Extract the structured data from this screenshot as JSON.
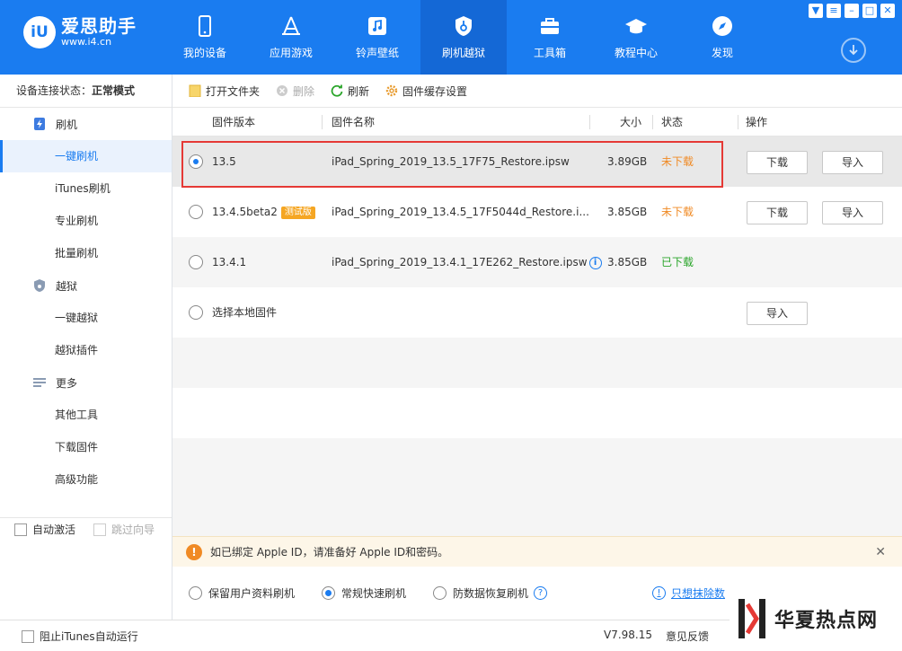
{
  "app": {
    "logo_mark": "iU",
    "name": "爱思助手",
    "url": "www.i4.cn"
  },
  "nav": {
    "items": [
      {
        "label": "我的设备",
        "icon": "phone-icon"
      },
      {
        "label": "应用游戏",
        "icon": "appstore-icon"
      },
      {
        "label": "铃声壁纸",
        "icon": "music-icon"
      },
      {
        "label": "刷机越狱",
        "icon": "shield-icon",
        "active": true
      },
      {
        "label": "工具箱",
        "icon": "toolbox-icon"
      },
      {
        "label": "教程中心",
        "icon": "graduation-cap-icon"
      },
      {
        "label": "发现",
        "icon": "compass-icon"
      }
    ],
    "download_icon": "download-circle-icon",
    "window_controls": [
      "shirt-icon",
      "menu-icon",
      "minimize-icon",
      "maximize-icon",
      "close-icon"
    ]
  },
  "sidebar": {
    "status_label": "设备连接状态：",
    "status_value": "正常模式",
    "groups": [
      {
        "label": "刷机",
        "icon": "flash-icon",
        "items": [
          "一键刷机",
          "iTunes刷机",
          "专业刷机",
          "批量刷机"
        ]
      },
      {
        "label": "越狱",
        "icon": "shield-icon",
        "items": [
          "一键越狱",
          "越狱插件"
        ]
      },
      {
        "label": "更多",
        "icon": "menu-lines-icon",
        "items": [
          "其他工具",
          "下载固件",
          "高级功能"
        ]
      }
    ],
    "active_item": "一键刷机",
    "auto_activate": "自动激活",
    "skip_guide": "跳过向导"
  },
  "toolbar": {
    "open_folder": "打开文件夹",
    "delete": "删除",
    "refresh": "刷新",
    "cache_settings": "固件缓存设置"
  },
  "table": {
    "headers": {
      "version": "固件版本",
      "name": "固件名称",
      "size": "大小",
      "status": "状态",
      "action": "操作"
    },
    "rows": [
      {
        "version": "13.5",
        "name": "iPad_Spring_2019_13.5_17F75_Restore.ipsw",
        "size": "3.89GB",
        "status": "未下载",
        "selected": true,
        "btn_download": "下载",
        "btn_import": "导入"
      },
      {
        "version": "13.4.5beta2",
        "badge": "测试版",
        "name": "iPad_Spring_2019_13.4.5_17F5044d_Restore.i...",
        "size": "3.85GB",
        "status": "未下载",
        "btn_download": "下载",
        "btn_import": "导入"
      },
      {
        "version": "13.4.1",
        "name": "iPad_Spring_2019_13.4.1_17E262_Restore.ipsw",
        "size": "3.85GB",
        "status": "已下载"
      },
      {
        "version": "选择本地固件",
        "btn_import": "导入"
      }
    ],
    "status_colors": {
      "not_downloaded": "#f08a24",
      "downloaded": "#2aa52a"
    }
  },
  "notice": {
    "text": "如已绑定 Apple ID，请准备好 Apple ID和密码。"
  },
  "modes": {
    "options": [
      "保留用户资料刷机",
      "常规快速刷机",
      "防数据恢复刷机"
    ],
    "selected": "常规快速刷机",
    "erase_link": "只想抹除数"
  },
  "statusbar": {
    "block_itunes": "阻止iTunes自动运行",
    "version": "V7.98.15",
    "feedback": "意见反馈"
  },
  "watermark": {
    "text": "华夏热点网"
  },
  "colors": {
    "accent": "#1a7cf0",
    "nav_active": "#1468d6",
    "highlight_border": "#e53935"
  }
}
